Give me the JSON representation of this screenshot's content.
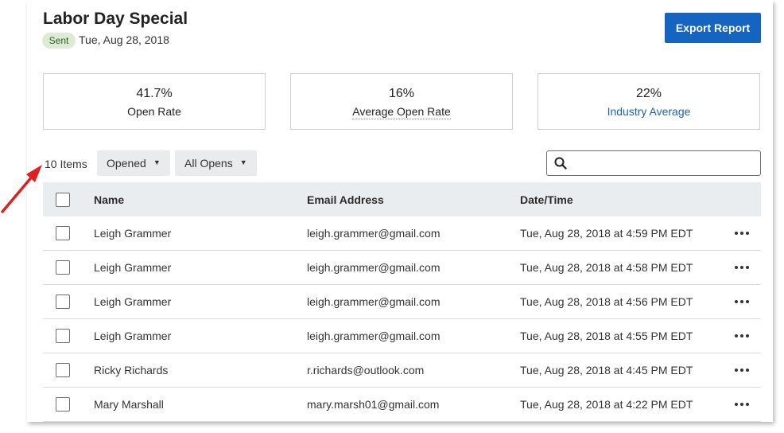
{
  "campaign": {
    "title": "Labor Day Special",
    "status_badge": "Sent",
    "sent_date": "Tue, Aug 28, 2018"
  },
  "actions": {
    "export_label": "Export Report"
  },
  "stats": [
    {
      "value": "41.7%",
      "label": "Open Rate"
    },
    {
      "value": "16%",
      "label": "Average Open Rate"
    },
    {
      "value": "22%",
      "label": "Industry Average"
    }
  ],
  "toolbar": {
    "items_count": "10 Items",
    "filter_opened": "Opened",
    "filter_all_opens": "All Opens",
    "search_value": ""
  },
  "table": {
    "headers": {
      "name": "Name",
      "email": "Email Address",
      "datetime": "Date/Time"
    },
    "rows": [
      {
        "name": "Leigh Grammer",
        "email": "leigh.grammer@gmail.com",
        "datetime": "Tue, Aug 28, 2018 at 4:59 PM EDT"
      },
      {
        "name": "Leigh Grammer",
        "email": "leigh.grammer@gmail.com",
        "datetime": "Tue, Aug 28, 2018 at 4:58 PM EDT"
      },
      {
        "name": "Leigh Grammer",
        "email": "leigh.grammer@gmail.com",
        "datetime": "Tue, Aug 28, 2018 at 4:56 PM EDT"
      },
      {
        "name": "Leigh Grammer",
        "email": "leigh.grammer@gmail.com",
        "datetime": "Tue, Aug 28, 2018 at 4:55 PM EDT"
      },
      {
        "name": "Ricky Richards",
        "email": "r.richards@outlook.com",
        "datetime": "Tue, Aug 28, 2018 at 4:45 PM EDT"
      },
      {
        "name": "Mary Marshall",
        "email": "mary.marsh01@gmail.com",
        "datetime": "Tue, Aug 28, 2018 at 4:22 PM EDT"
      }
    ]
  },
  "colors": {
    "primary": "#1565c0",
    "badge_bg": "#dcebd3",
    "link": "#1f5fb0",
    "annotation_arrow": "#e02020"
  },
  "icons": {
    "search": "search-icon",
    "dropdown": "chevron-down-icon",
    "row_menu": "more-horizontal-icon",
    "annotation": "arrow-annotation-icon"
  }
}
